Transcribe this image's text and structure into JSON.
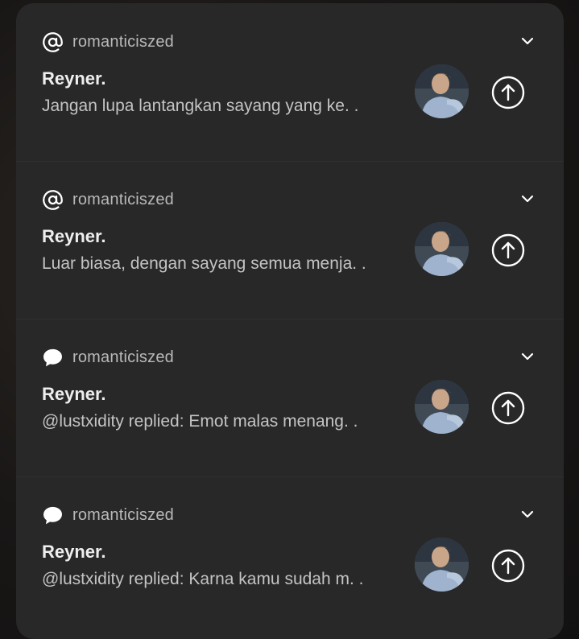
{
  "notifications": [
    {
      "app_icon": "at-sign-icon",
      "app_name": "romanticiszed",
      "title": "Reyner.",
      "body": "Jangan lupa lantangkan sayang yang ke. .",
      "avatar": "profile-photo",
      "action_icon": "arrow-up-circle-icon"
    },
    {
      "app_icon": "at-sign-icon",
      "app_name": "romanticiszed",
      "title": "Reyner.",
      "body": "Luar biasa, dengan sayang semua menja. .",
      "avatar": "profile-photo",
      "action_icon": "arrow-up-circle-icon"
    },
    {
      "app_icon": "speech-bubble-icon",
      "app_name": "romanticiszed",
      "title": "Reyner.",
      "body": "@lustxidity replied: Emot malas menang. .",
      "avatar": "profile-photo",
      "action_icon": "arrow-up-circle-icon"
    },
    {
      "app_icon": "speech-bubble-icon",
      "app_name": "romanticiszed",
      "title": "Reyner.",
      "body": "@lustxidity replied: Karna kamu sudah m. .",
      "avatar": "profile-photo",
      "action_icon": "arrow-up-circle-icon"
    }
  ],
  "colors": {
    "panel": "#282828",
    "title": "#eeeeee",
    "body": "#c4c4c4",
    "app_name": "#b9b9b9",
    "icon": "#ffffff"
  }
}
